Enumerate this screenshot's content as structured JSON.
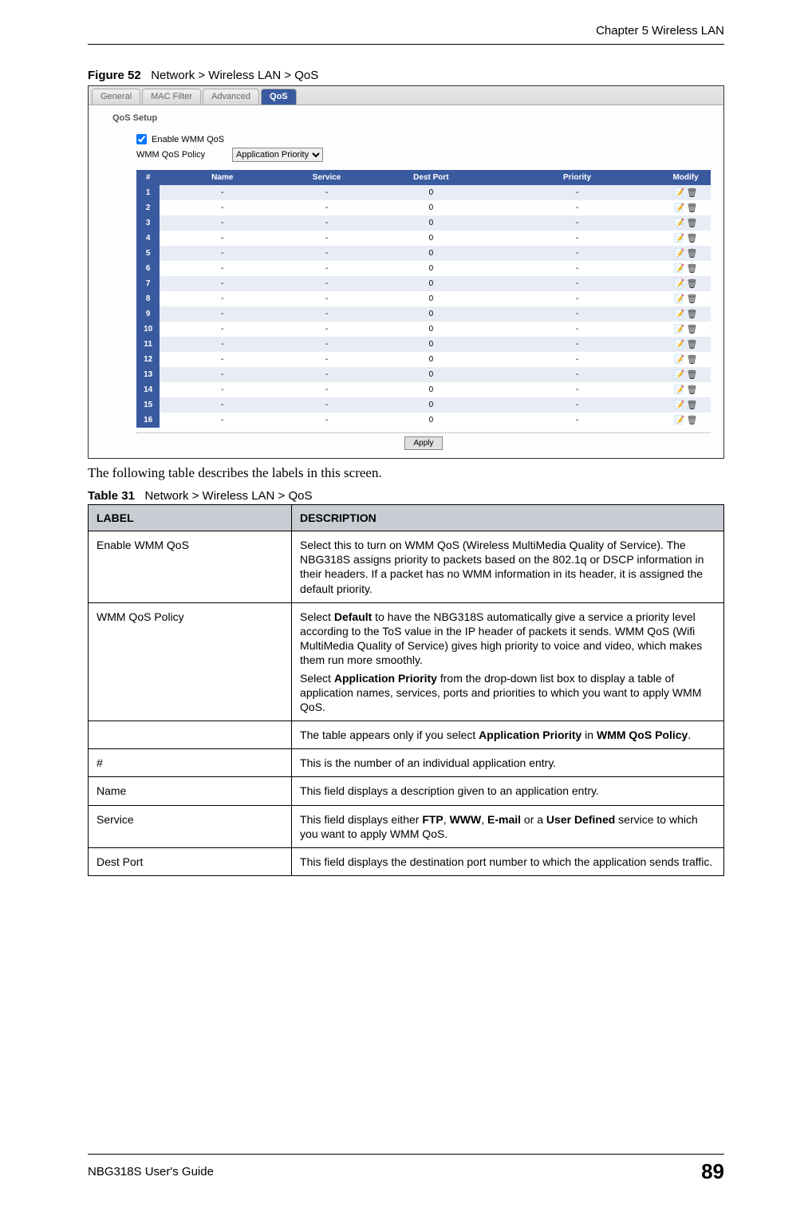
{
  "header": {
    "chapter": "Chapter 5 Wireless LAN"
  },
  "figure": {
    "label": "Figure 52",
    "title": "Network > Wireless LAN > QoS"
  },
  "screenshot": {
    "tabs": [
      "General",
      "MAC Filter",
      "Advanced",
      "QoS"
    ],
    "active_tab_index": 3,
    "section_label": "QoS Setup",
    "enable_label": "Enable WMM QoS",
    "enable_checked": true,
    "policy_label": "WMM QoS Policy",
    "policy_value": "Application Priority",
    "columns": [
      "#",
      "Name",
      "Service",
      "Dest Port",
      "Priority",
      "Modify"
    ],
    "rows": [
      {
        "n": "1",
        "name": "-",
        "service": "-",
        "port": "0",
        "priority": "-"
      },
      {
        "n": "2",
        "name": "-",
        "service": "-",
        "port": "0",
        "priority": "-"
      },
      {
        "n": "3",
        "name": "-",
        "service": "-",
        "port": "0",
        "priority": "-"
      },
      {
        "n": "4",
        "name": "-",
        "service": "-",
        "port": "0",
        "priority": "-"
      },
      {
        "n": "5",
        "name": "-",
        "service": "-",
        "port": "0",
        "priority": "-"
      },
      {
        "n": "6",
        "name": "-",
        "service": "-",
        "port": "0",
        "priority": "-"
      },
      {
        "n": "7",
        "name": "-",
        "service": "-",
        "port": "0",
        "priority": "-"
      },
      {
        "n": "8",
        "name": "-",
        "service": "-",
        "port": "0",
        "priority": "-"
      },
      {
        "n": "9",
        "name": "-",
        "service": "-",
        "port": "0",
        "priority": "-"
      },
      {
        "n": "10",
        "name": "-",
        "service": "-",
        "port": "0",
        "priority": "-"
      },
      {
        "n": "11",
        "name": "-",
        "service": "-",
        "port": "0",
        "priority": "-"
      },
      {
        "n": "12",
        "name": "-",
        "service": "-",
        "port": "0",
        "priority": "-"
      },
      {
        "n": "13",
        "name": "-",
        "service": "-",
        "port": "0",
        "priority": "-"
      },
      {
        "n": "14",
        "name": "-",
        "service": "-",
        "port": "0",
        "priority": "-"
      },
      {
        "n": "15",
        "name": "-",
        "service": "-",
        "port": "0",
        "priority": "-"
      },
      {
        "n": "16",
        "name": "-",
        "service": "-",
        "port": "0",
        "priority": "-"
      }
    ],
    "apply_label": "Apply"
  },
  "intro_text": "The following table describes the labels in this screen.",
  "table_caption": {
    "label": "Table 31",
    "title": "Network > Wireless LAN > QoS"
  },
  "desc_table": {
    "headers": [
      "LABEL",
      "DESCRIPTION"
    ],
    "rows": [
      {
        "label": "Enable WMM QoS",
        "desc_html": "Select this to turn on WMM QoS (Wireless MultiMedia Quality of Service). The NBG318S assigns priority to packets based on the 802.1q or DSCP information in their headers. If a packet has no WMM information in its header, it is assigned the default priority."
      },
      {
        "label": "WMM QoS Policy",
        "desc_html": "<p>Select <b>Default</b> to have the NBG318S automatically give a service a priority level according to the ToS value in the IP header of packets it sends. WMM QoS (Wifi MultiMedia Quality of Service) gives high priority to voice and video, which makes them run more smoothly.</p><p>Select <b>Application Priority</b> from the drop-down list box to display a table of application names, services, ports and priorities to which you want to apply WMM QoS.</p>"
      },
      {
        "label": "",
        "desc_html": "The table appears only if you select <b>Application Priority</b> in <b>WMM QoS Policy</b>."
      },
      {
        "label": "#",
        "desc_html": "This is the number of an individual application entry."
      },
      {
        "label": "Name",
        "desc_html": "This field displays a description given to an application entry."
      },
      {
        "label": "Service",
        "desc_html": "This field displays either <b>FTP</b>, <b>WWW</b>, <b>E-mail</b> or a <b>User Defined</b> service to which you want to apply WMM QoS."
      },
      {
        "label": "Dest Port",
        "desc_html": "This field displays the destination port number to which the application sends traffic."
      }
    ]
  },
  "footer": {
    "guide": "NBG318S User's Guide",
    "page": "89"
  }
}
